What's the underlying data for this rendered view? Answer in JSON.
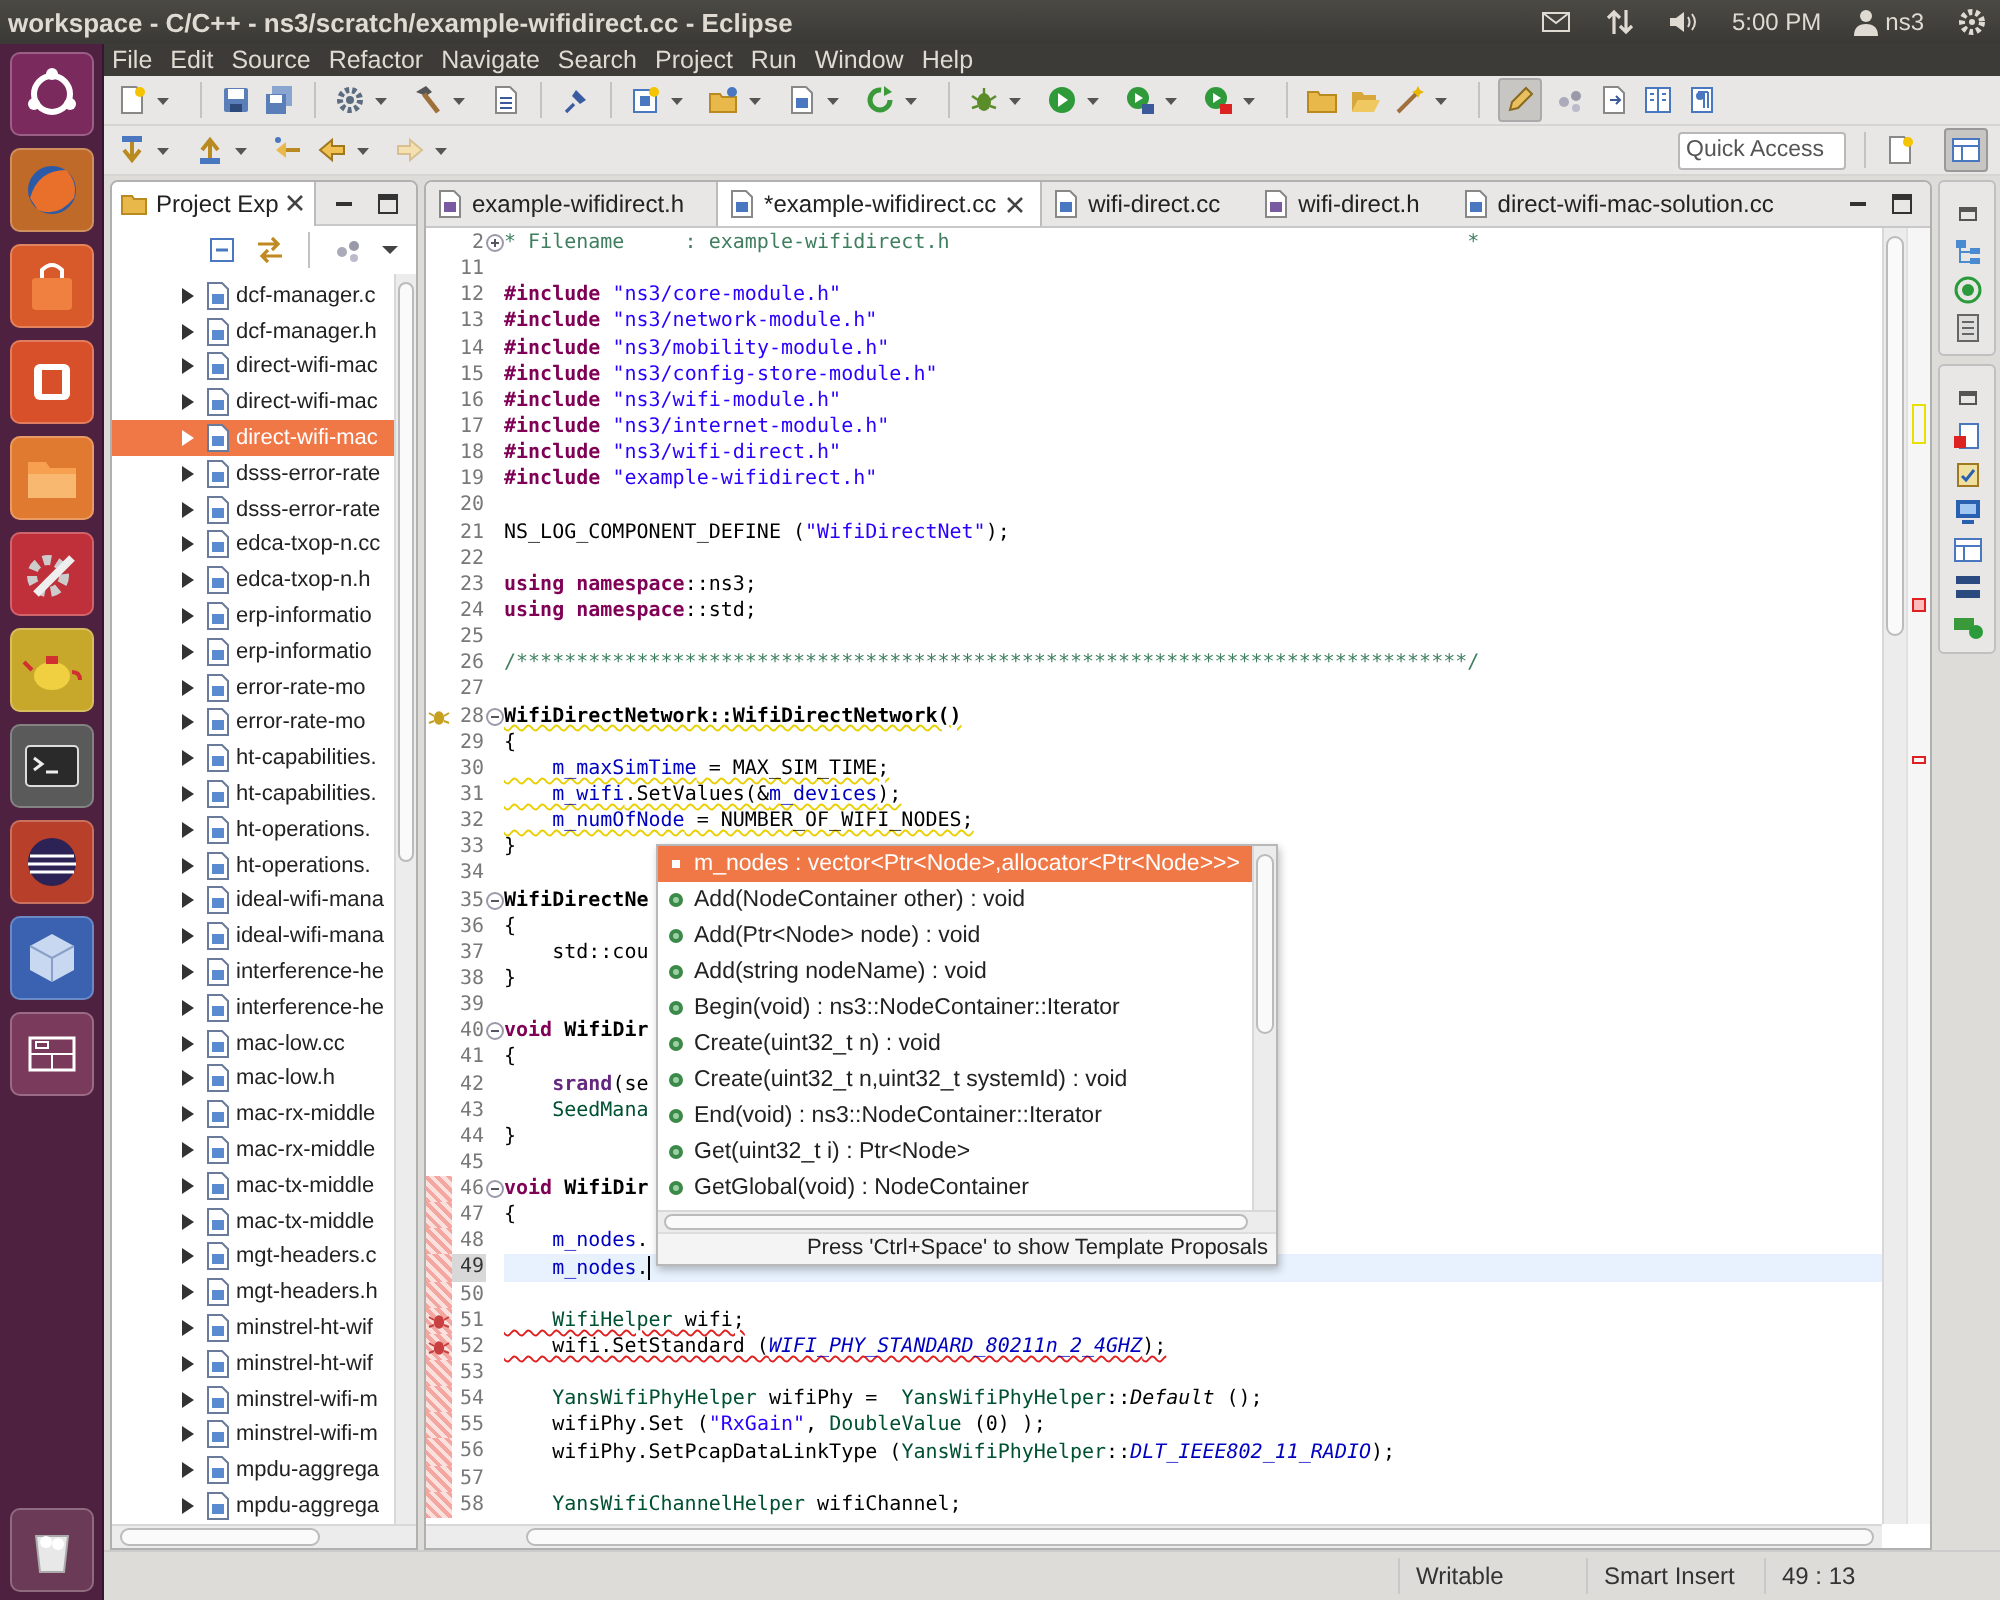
{
  "top_panel": {
    "title": "workspace - C/C++ - ns3/scratch/example-wifidirect.cc - Eclipse",
    "time": "5:00 PM",
    "user": "ns3"
  },
  "menu": [
    "File",
    "Edit",
    "Source",
    "Refactor",
    "Navigate",
    "Search",
    "Project",
    "Run",
    "Window",
    "Help"
  ],
  "quick_access": {
    "placeholder": "Quick Access"
  },
  "project_explorer": {
    "title": "Project Exp",
    "items": [
      {
        "label": "dcf-manager.c",
        "selected": false,
        "expanded": false
      },
      {
        "label": "dcf-manager.h",
        "selected": false,
        "expanded": false
      },
      {
        "label": "direct-wifi-mac",
        "selected": false,
        "expanded": false
      },
      {
        "label": "direct-wifi-mac",
        "selected": false,
        "expanded": false
      },
      {
        "label": "direct-wifi-mac",
        "selected": true,
        "expanded": false
      },
      {
        "label": "dsss-error-rate",
        "selected": false,
        "expanded": false
      },
      {
        "label": "dsss-error-rate",
        "selected": false,
        "expanded": false
      },
      {
        "label": "edca-txop-n.cc",
        "selected": false,
        "expanded": false
      },
      {
        "label": "edca-txop-n.h",
        "selected": false,
        "expanded": false
      },
      {
        "label": "erp-informatio",
        "selected": false,
        "expanded": false
      },
      {
        "label": "erp-informatio",
        "selected": false,
        "expanded": false
      },
      {
        "label": "error-rate-mo",
        "selected": false,
        "expanded": false
      },
      {
        "label": "error-rate-mo",
        "selected": false,
        "expanded": false
      },
      {
        "label": "ht-capabilities.",
        "selected": false,
        "expanded": false
      },
      {
        "label": "ht-capabilities.",
        "selected": false,
        "expanded": false
      },
      {
        "label": "ht-operations.",
        "selected": false,
        "expanded": false
      },
      {
        "label": "ht-operations.",
        "selected": false,
        "expanded": false
      },
      {
        "label": "ideal-wifi-mana",
        "selected": false,
        "expanded": false
      },
      {
        "label": "ideal-wifi-mana",
        "selected": false,
        "expanded": false
      },
      {
        "label": "interference-he",
        "selected": false,
        "expanded": false
      },
      {
        "label": "interference-he",
        "selected": false,
        "expanded": false
      },
      {
        "label": "mac-low.cc",
        "selected": false,
        "expanded": false
      },
      {
        "label": "mac-low.h",
        "selected": false,
        "expanded": false
      },
      {
        "label": "mac-rx-middle",
        "selected": false,
        "expanded": false
      },
      {
        "label": "mac-rx-middle",
        "selected": false,
        "expanded": false
      },
      {
        "label": "mac-tx-middle",
        "selected": false,
        "expanded": false
      },
      {
        "label": "mac-tx-middle",
        "selected": false,
        "expanded": false
      },
      {
        "label": "mgt-headers.c",
        "selected": false,
        "expanded": false
      },
      {
        "label": "mgt-headers.h",
        "selected": false,
        "expanded": false
      },
      {
        "label": "minstrel-ht-wif",
        "selected": false,
        "expanded": false
      },
      {
        "label": "minstrel-ht-wif",
        "selected": false,
        "expanded": false
      },
      {
        "label": "minstrel-wifi-m",
        "selected": false,
        "expanded": false
      },
      {
        "label": "minstrel-wifi-m",
        "selected": false,
        "expanded": false
      },
      {
        "label": "mpdu-aggrega",
        "selected": false,
        "expanded": false
      },
      {
        "label": "mpdu-aggrega",
        "selected": false,
        "expanded": false
      }
    ]
  },
  "editor": {
    "tabs": [
      {
        "label": "example-wifidirect.h",
        "kind": "header",
        "selected": false
      },
      {
        "label": "*example-wifidirect.cc",
        "kind": "source",
        "selected": true
      },
      {
        "label": "wifi-direct.cc",
        "kind": "source",
        "selected": false
      },
      {
        "label": "wifi-direct.h",
        "kind": "header",
        "selected": false
      },
      {
        "label": "direct-wifi-mac-solution.cc",
        "kind": "source",
        "selected": false
      }
    ],
    "lines": [
      {
        "number": "2",
        "collapsed": true,
        "changed": false,
        "current": false,
        "tokens": [
          {
            "kind": "cmt",
            "text": "* Filename     : example-wifidirect.h                                           *"
          }
        ]
      },
      {
        "number": "11",
        "changed": false,
        "current": false
      },
      {
        "number": "12",
        "changed": false,
        "current": false,
        "tokens": [
          {
            "kind": "kw",
            "text": "#include"
          },
          {
            "kind": "str",
            "text": " \"ns3/core-module.h\""
          }
        ]
      },
      {
        "number": "13",
        "changed": false,
        "current": false,
        "tokens": [
          {
            "kind": "kw",
            "text": "#include"
          },
          {
            "kind": "str",
            "text": " \"ns3/network-module.h\""
          }
        ]
      },
      {
        "number": "14",
        "changed": false,
        "current": false,
        "tokens": [
          {
            "kind": "kw",
            "text": "#include"
          },
          {
            "kind": "str",
            "text": " \"ns3/mobility-module.h\""
          }
        ]
      },
      {
        "number": "15",
        "changed": false,
        "current": false,
        "tokens": [
          {
            "kind": "kw",
            "text": "#include"
          },
          {
            "kind": "str",
            "text": " \"ns3/config-store-module.h\""
          }
        ]
      },
      {
        "number": "16",
        "changed": false,
        "current": false,
        "tokens": [
          {
            "kind": "kw",
            "text": "#include"
          },
          {
            "kind": "str",
            "text": " \"ns3/wifi-module.h\""
          }
        ]
      },
      {
        "number": "17",
        "changed": false,
        "current": false,
        "tokens": [
          {
            "kind": "kw",
            "text": "#include"
          },
          {
            "kind": "str",
            "text": " \"ns3/internet-module.h\""
          }
        ]
      },
      {
        "number": "18",
        "changed": false,
        "current": false,
        "tokens": [
          {
            "kind": "kw",
            "text": "#include"
          },
          {
            "kind": "str",
            "text": " \"ns3/wifi-direct.h\""
          }
        ]
      },
      {
        "number": "19",
        "changed": false,
        "current": false,
        "tokens": [
          {
            "kind": "kw",
            "text": "#include"
          },
          {
            "kind": "str",
            "text": " \"example-wifidirect.h\""
          }
        ]
      },
      {
        "number": "20",
        "changed": false,
        "current": false
      },
      {
        "number": "21",
        "changed": false,
        "current": false,
        "tokens": [
          {
            "kind": "plain",
            "text": "NS_LOG_COMPONENT_DEFINE ("
          },
          {
            "kind": "str",
            "text": "\"WifiDirectNet\""
          },
          {
            "kind": "plain",
            "text": ");"
          }
        ]
      },
      {
        "number": "22",
        "changed": false,
        "current": false
      },
      {
        "number": "23",
        "changed": false,
        "current": false,
        "tokens": [
          {
            "kind": "kw",
            "text": "using"
          },
          {
            "kind": "kw",
            "text": " namespace"
          },
          {
            "kind": "plain",
            "text": "::ns3;"
          }
        ]
      },
      {
        "number": "24",
        "changed": false,
        "current": false,
        "tokens": [
          {
            "kind": "kw",
            "text": "using"
          },
          {
            "kind": "kw",
            "text": " namespace"
          },
          {
            "kind": "plain",
            "text": "::std;"
          }
        ]
      },
      {
        "number": "25",
        "changed": false,
        "current": false
      },
      {
        "number": "26",
        "changed": false,
        "current": false,
        "tokens": [
          {
            "kind": "cmt",
            "text": "/*******************************************************************************/"
          }
        ]
      },
      {
        "number": "27",
        "changed": false,
        "current": false
      },
      {
        "number": "28",
        "collapsed": false,
        "annotation": {
          "kind": "warning"
        },
        "squiggle": {
          "kind": "warning"
        },
        "changed": false,
        "current": false,
        "tokens": [
          {
            "kind": "bold",
            "text": "WifiDirectNetwork::WifiDirectNetwork()"
          }
        ]
      },
      {
        "number": "29",
        "changed": false,
        "current": false,
        "tokens": [
          {
            "kind": "plain",
            "text": "{"
          }
        ]
      },
      {
        "number": "30",
        "squiggle": {
          "kind": "warning"
        },
        "changed": false,
        "current": false,
        "tokens": [
          {
            "kind": "field",
            "text": "    m_maxSimTime"
          },
          {
            "kind": "plain",
            "text": " = MAX_SIM_TIME;"
          }
        ]
      },
      {
        "number": "31",
        "squiggle": {
          "kind": "warning"
        },
        "changed": false,
        "current": false,
        "tokens": [
          {
            "kind": "field",
            "text": "    m_wifi"
          },
          {
            "kind": "plain",
            "text": ".SetValues(&"
          },
          {
            "kind": "field",
            "text": "m_devices"
          },
          {
            "kind": "plain",
            "text": ");"
          }
        ]
      },
      {
        "number": "32",
        "squiggle": {
          "kind": "warning"
        },
        "changed": false,
        "current": false,
        "tokens": [
          {
            "kind": "field",
            "text": "    m_numOfNode"
          },
          {
            "kind": "plain",
            "text": " = NUMBER_OF_WIFI_NODES;"
          }
        ]
      },
      {
        "number": "33",
        "changed": false,
        "current": false,
        "tokens": [
          {
            "kind": "plain",
            "text": "}"
          }
        ]
      },
      {
        "number": "34",
        "changed": false,
        "current": false
      },
      {
        "number": "35",
        "collapsed": false,
        "changed": false,
        "current": false,
        "tokens": [
          {
            "kind": "bold",
            "text": "WifiDirectNe"
          }
        ]
      },
      {
        "number": "36",
        "changed": false,
        "current": false,
        "tokens": [
          {
            "kind": "plain",
            "text": "{"
          }
        ]
      },
      {
        "number": "37",
        "changed": false,
        "current": false,
        "tokens": [
          {
            "kind": "plain",
            "text": "    std::cou"
          }
        ]
      },
      {
        "number": "38",
        "changed": false,
        "current": false,
        "tokens": [
          {
            "kind": "plain",
            "text": "}"
          }
        ]
      },
      {
        "number": "39",
        "changed": false,
        "current": false
      },
      {
        "number": "40",
        "collapsed": false,
        "changed": false,
        "current": false,
        "tokens": [
          {
            "kind": "kw",
            "text": "void"
          },
          {
            "kind": "bold",
            "text": " WifiDir"
          }
        ]
      },
      {
        "number": "41",
        "changed": false,
        "current": false,
        "tokens": [
          {
            "kind": "plain",
            "text": "{"
          }
        ]
      },
      {
        "number": "42",
        "changed": false,
        "current": false,
        "tokens": [
          {
            "kind": "func",
            "text": "    srand"
          },
          {
            "kind": "plain",
            "text": "(se"
          }
        ]
      },
      {
        "number": "43",
        "changed": false,
        "current": false,
        "tokens": [
          {
            "kind": "type",
            "text": "    SeedMana"
          }
        ]
      },
      {
        "number": "44",
        "changed": false,
        "current": false,
        "tokens": [
          {
            "kind": "plain",
            "text": "}"
          }
        ]
      },
      {
        "number": "45",
        "changed": false,
        "current": false
      },
      {
        "number": "46",
        "collapsed": false,
        "changed": true,
        "current": false,
        "tokens": [
          {
            "kind": "kw",
            "text": "void"
          },
          {
            "kind": "bold",
            "text": " WifiDir"
          }
        ]
      },
      {
        "number": "47",
        "changed": true,
        "current": false,
        "tokens": [
          {
            "kind": "plain",
            "text": "{"
          }
        ]
      },
      {
        "number": "48",
        "changed": true,
        "current": false,
        "tokens": [
          {
            "kind": "field",
            "text": "    m_nodes"
          },
          {
            "kind": "plain",
            "text": "."
          }
        ]
      },
      {
        "number": "49",
        "changed": true,
        "current": true,
        "tokens": [
          {
            "kind": "field",
            "text": "    m_nodes"
          },
          {
            "kind": "plain",
            "text": "."
          }
        ]
      },
      {
        "number": "50",
        "changed": true,
        "current": false
      },
      {
        "number": "51",
        "annotation": {
          "kind": "error"
        },
        "squiggle": {
          "kind": "error"
        },
        "changed": true,
        "current": false,
        "tokens": [
          {
            "kind": "type",
            "text": "    WifiHelper"
          },
          {
            "kind": "plain",
            "text": " wifi;"
          }
        ]
      },
      {
        "number": "52",
        "annotation": {
          "kind": "error"
        },
        "squiggle": {
          "kind": "error"
        },
        "changed": true,
        "current": false,
        "tokens": [
          {
            "kind": "plain",
            "text": "    wifi.SetStandard ("
          },
          {
            "kind": "enum",
            "text": "WIFI_PHY_STANDARD_80211n_2_4GHZ"
          },
          {
            "kind": "plain",
            "text": ");"
          }
        ]
      },
      {
        "number": "53",
        "changed": true,
        "current": false
      },
      {
        "number": "54",
        "changed": true,
        "current": false,
        "tokens": [
          {
            "kind": "type",
            "text": "    YansWifiPhyHelper"
          },
          {
            "kind": "plain",
            "text": " wifiPhy =  "
          },
          {
            "kind": "type",
            "text": "YansWifiPhyHelper"
          },
          {
            "kind": "plain",
            "text": "::"
          },
          {
            "kind": "italic",
            "text": "Default"
          },
          {
            "kind": "plain",
            "text": " ();"
          }
        ]
      },
      {
        "number": "55",
        "changed": true,
        "current": false,
        "tokens": [
          {
            "kind": "plain",
            "text": "    wifiPhy.Set ("
          },
          {
            "kind": "str",
            "text": "\"RxGain\""
          },
          {
            "kind": "plain",
            "text": ", "
          },
          {
            "kind": "type",
            "text": "DoubleValue"
          },
          {
            "kind": "plain",
            "text": " (0) );"
          }
        ]
      },
      {
        "number": "56",
        "changed": true,
        "current": false,
        "tokens": [
          {
            "kind": "plain",
            "text": "    wifiPhy.SetPcapDataLinkType ("
          },
          {
            "kind": "type",
            "text": "YansWifiPhyHelper"
          },
          {
            "kind": "plain",
            "text": "::"
          },
          {
            "kind": "enum",
            "text": "DLT_IEEE802_11_RADIO"
          },
          {
            "kind": "plain",
            "text": ");"
          }
        ]
      },
      {
        "number": "57",
        "changed": true,
        "current": false
      },
      {
        "number": "58",
        "changed": true,
        "current": false,
        "tokens": [
          {
            "kind": "type",
            "text": "    YansWifiChannelHelper"
          },
          {
            "kind": "plain",
            "text": " wifiChannel;"
          }
        ]
      }
    ]
  },
  "completion": {
    "items": [
      {
        "text": "m_nodes : vector<Ptr<Node>,allocator<Ptr<Node>>>",
        "kind": "field",
        "selected": true
      },
      {
        "text": "Add(NodeContainer other) : void",
        "kind": "method",
        "selected": false
      },
      {
        "text": "Add(Ptr<Node> node) : void",
        "kind": "method",
        "selected": false
      },
      {
        "text": "Add(string nodeName) : void",
        "kind": "method",
        "selected": false
      },
      {
        "text": "Begin(void) : ns3::NodeContainer::Iterator",
        "kind": "method",
        "selected": false
      },
      {
        "text": "Create(uint32_t n) : void",
        "kind": "method",
        "selected": false
      },
      {
        "text": "Create(uint32_t n,uint32_t systemId) : void",
        "kind": "method",
        "selected": false
      },
      {
        "text": "End(void) : ns3::NodeContainer::Iterator",
        "kind": "method",
        "selected": false
      },
      {
        "text": "Get(uint32_t i) : Ptr<Node>",
        "kind": "method",
        "selected": false
      },
      {
        "text": "GetGlobal(void) : NodeContainer",
        "kind": "method",
        "selected": false
      }
    ],
    "footer": "Press 'Ctrl+Space' to show Template Proposals"
  },
  "status_bar": {
    "mode": "Writable",
    "insert_mode": "Smart Insert",
    "position": "49 : 13"
  }
}
